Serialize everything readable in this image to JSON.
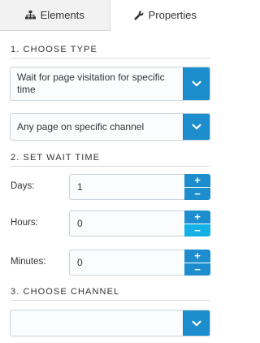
{
  "tabs": [
    {
      "label": "Elements",
      "icon": "sitemap-icon"
    },
    {
      "label": "Properties",
      "icon": "wrench-icon"
    }
  ],
  "sections": {
    "choose_type": "1. CHOOSE TYPE",
    "set_wait_time": "2. SET WAIT TIME",
    "choose_channel": "3. CHOOSE CHANNEL"
  },
  "type_select": {
    "value": "Wait for page visitation for specific time"
  },
  "page_select": {
    "value": "Any page on specific channel"
  },
  "wait_time": {
    "days": {
      "label": "Days:",
      "value": "1"
    },
    "hours": {
      "label": "Hours:",
      "value": "0"
    },
    "minutes": {
      "label": "Minutes:",
      "value": "0"
    }
  },
  "channel_select": {
    "value": ""
  },
  "stepper": {
    "plus": "+",
    "minus": "−"
  },
  "colors": {
    "accent": "#1d8dce",
    "accent_active": "#14b1e6"
  }
}
